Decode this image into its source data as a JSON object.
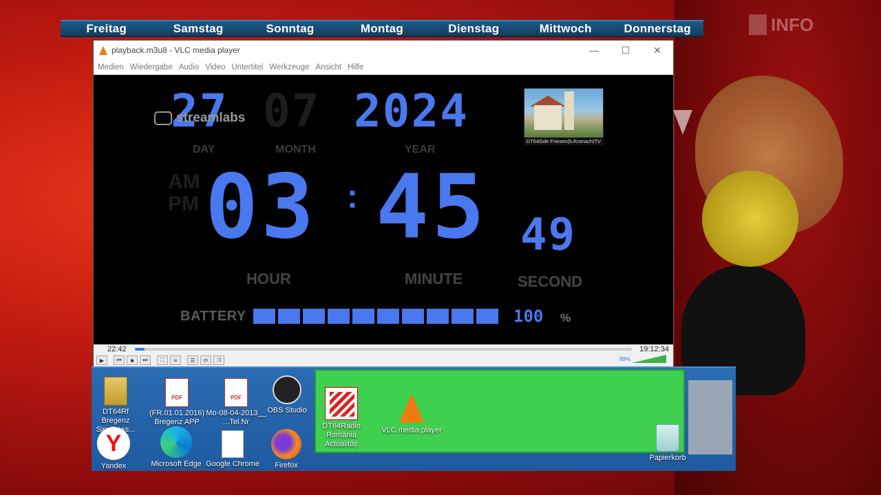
{
  "tv": {
    "days": [
      "Freitag",
      "Samstag",
      "Sonntag",
      "Montag",
      "Dienstag",
      "Mittwoch",
      "Donnerstag"
    ],
    "channel_logo": "INFO"
  },
  "vlc": {
    "title": "playback.m3u8 - VLC media player",
    "window_controls": {
      "minimize": "—",
      "maximize": "☐",
      "close": "✕"
    },
    "menu": [
      "Medien",
      "Wiedergabe",
      "Audio",
      "Video",
      "Untertitel",
      "Werkzeuge",
      "Ansicht",
      "Hilfe"
    ],
    "time_elapsed": "22:42",
    "time_total": "19:12:34",
    "progress_fraction": 0.02,
    "volume_label": "89%",
    "control_buttons": [
      "play-icon",
      "prev-icon",
      "stop-icon",
      "next-icon",
      "fullscreen-icon",
      "extended-settings-icon",
      "playlist-icon",
      "loop-icon",
      "shuffle-icon"
    ]
  },
  "clock": {
    "streamlabs_label": "streamlabs",
    "day": "27",
    "month": "07",
    "year": "2024",
    "day_label": "DAY",
    "month_label": "MONTH",
    "year_label": "YEAR",
    "am": "AM",
    "pm": "PM",
    "hour": "03",
    "minute": "45",
    "second": "49",
    "hour_label": "HOUR",
    "minute_label": "MINUTE",
    "second_label": "SECOND",
    "battery_label": "BATTERY",
    "battery_cells": 10,
    "battery_value": "100",
    "battery_unit": "%",
    "thumbnail_caption": "DT64Gde Friesen(b.Kronach)TV"
  },
  "desktop": {
    "icons": [
      {
        "name": "DT64Rf Bregenz Singiboss...",
        "line1": "DT64Rf",
        "line2": "Bregenz Singiboss..."
      },
      {
        "name": "(FR.01.01.2016)",
        "line1": "(FR.01.01.2016)",
        "line2": "Bregenz APP"
      },
      {
        "name": "Mo-08-04-2013",
        "line1": "Mo-08-04-2013__",
        "line2": "...Tel.Nr"
      },
      {
        "name": "OBS Studio",
        "line1": "OBS Studio",
        "line2": ""
      },
      {
        "name": "DT64Radio România Actualități",
        "line1": "DT64Radio România",
        "line2": "Actualități"
      },
      {
        "name": "VLC media player",
        "line1": "VLC media player",
        "line2": ""
      },
      {
        "name": "Yandex",
        "line1": "Yandex",
        "line2": ""
      },
      {
        "name": "Microsoft Edge",
        "line1": "Microsoft Edge",
        "line2": ""
      },
      {
        "name": "Google Chrome",
        "line1": "Google Chrome",
        "line2": ""
      },
      {
        "name": "Firefox",
        "line1": "Firefox",
        "line2": ""
      },
      {
        "name": "Papierkorb",
        "line1": "Papierkorb",
        "line2": ""
      }
    ]
  },
  "colors": {
    "clock_blue": "#4a78ee",
    "green_panel": "#3fd04f",
    "days_bar": "#1c5a86"
  }
}
